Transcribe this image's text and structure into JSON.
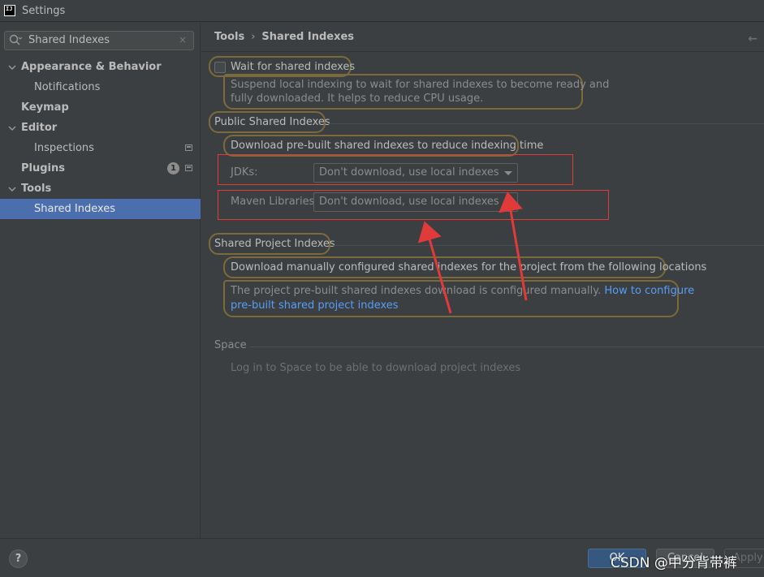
{
  "window": {
    "title": "Settings",
    "app_icon": "IJ"
  },
  "search": {
    "value": "Shared Indexes",
    "clear": "×"
  },
  "sidebar": {
    "items": [
      {
        "label": "Appearance & Behavior"
      },
      {
        "label": "Notifications"
      },
      {
        "label": "Keymap"
      },
      {
        "label": "Editor"
      },
      {
        "label": "Inspections"
      },
      {
        "label": "Plugins",
        "badge": "1"
      },
      {
        "label": "Tools"
      },
      {
        "label": "Shared Indexes"
      }
    ]
  },
  "breadcrumb": {
    "parent": "Tools",
    "separator": "›",
    "current": "Shared Indexes",
    "back": "←"
  },
  "wait": {
    "label": "Wait for shared indexes",
    "desc_line1": "Suspend local indexing to wait for shared indexes to become ready and",
    "desc_line2": "fully downloaded. It helps to reduce CPU usage."
  },
  "public": {
    "heading": "Public Shared Indexes",
    "desc": "Download pre-built shared indexes to reduce indexing time",
    "jdks_label": "JDKs:",
    "jdks_value": "Don't download, use local indexes",
    "maven_label": "Maven Libraries:",
    "maven_value": "Don't download, use local indexes"
  },
  "project": {
    "heading": "Shared Project Indexes",
    "desc": "Download manually configured shared indexes for the project from the following locations",
    "note": "The project pre-built shared indexes download is configured manually.",
    "link_part1": "How to configure",
    "link_part2": "pre-built shared project indexes"
  },
  "space": {
    "heading": "Space",
    "desc": "Log in to Space to be able to download project indexes"
  },
  "footer": {
    "help": "?",
    "ok": "OK",
    "cancel": "Cancel",
    "apply": "Apply",
    "watermark": "CSDN @中分背带裤"
  },
  "colors": {
    "accent": "#4b6eaf",
    "highlight": "#7d6a3c",
    "annotation": "#e03a3a",
    "link": "#589df6"
  }
}
